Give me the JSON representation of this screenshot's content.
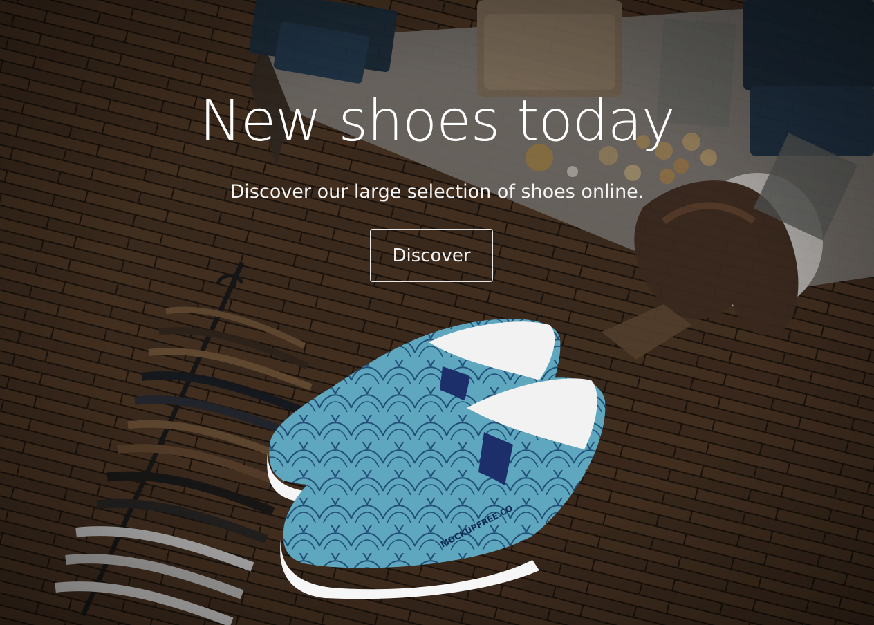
{
  "hero": {
    "title": "New shoes today",
    "subtitle": "Discover our large selection of shoes online.",
    "button_label": "Discover"
  },
  "product": {
    "shoe_brand_text": "MOCKUPFREE.CO"
  },
  "colors": {
    "text": "#ffffff",
    "button_border": "#e9e9e9",
    "background_dark": "#1e1711",
    "floor_wood": "#4a3626",
    "shoe_blue": "#5b9fb8",
    "shoe_pattern": "#1f4f7a",
    "shoe_sole": "#f4f4f4"
  }
}
